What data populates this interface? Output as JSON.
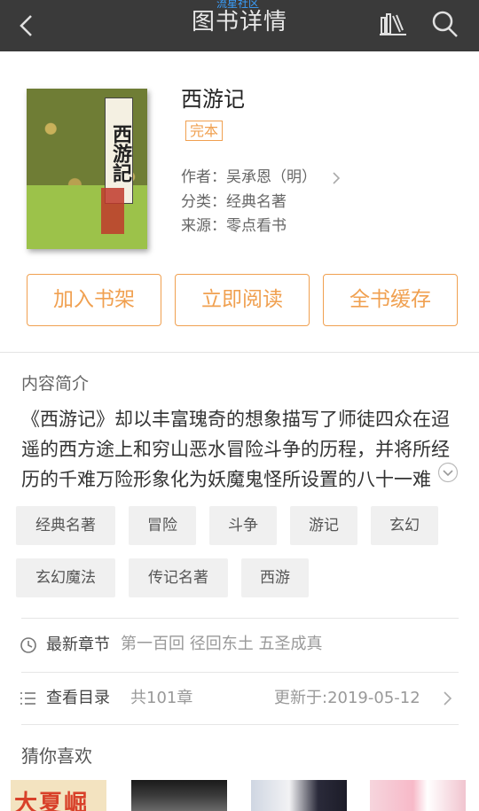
{
  "header": {
    "title": "图书详情",
    "watermark": "流星社区"
  },
  "book": {
    "title": "西游记",
    "status_badge": "完本",
    "author": "作者：吴承恩（明）",
    "category": "分类：经典名著",
    "source": "来源：零点看书",
    "cover_label": "西游記"
  },
  "actions": {
    "add_to_shelf": "加入书架",
    "read_now": "立即阅读",
    "cache_all": "全书缓存"
  },
  "intro": {
    "heading": "内容简介",
    "text": "《西游记》却以丰富瑰奇的想象描写了师徒四众在迢遥的西方途上和穷山恶水冒险斗争的历程，并将所经历的千难万险形象化为妖魔鬼怪所设置的八十一难"
  },
  "tags": [
    "经典名著",
    "冒险",
    "斗争",
    "游记",
    "玄幻",
    "玄幻魔法",
    "传记名著",
    "西游"
  ],
  "latest_chapter": {
    "label": "最新章节",
    "value": "第一百回 径回东土 五圣成真"
  },
  "catalog": {
    "label": "查看目录",
    "count": "共101章",
    "updated": "更新于:2019-05-12"
  },
  "recommend": {
    "heading": "猜你喜欢",
    "thumb1_text": "大夏崛起"
  },
  "colors": {
    "accent": "#f0a050",
    "topbar": "#3a3a3a"
  }
}
